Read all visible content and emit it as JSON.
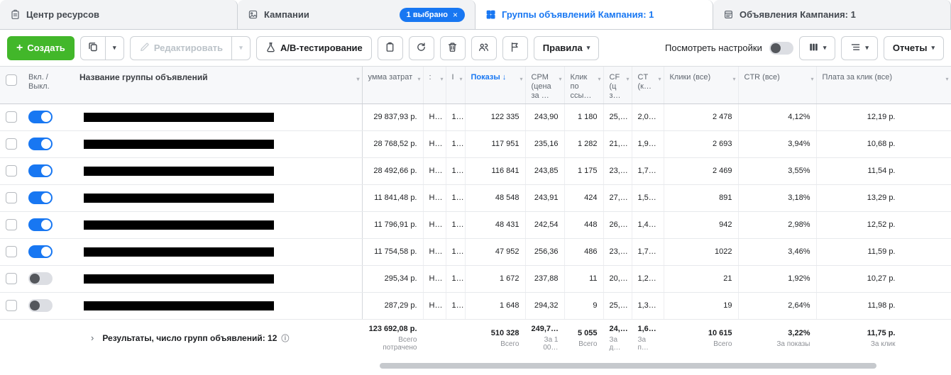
{
  "colors": {
    "accent": "#1877f2",
    "create_button": "#42b72a",
    "toggle_on": "#1877f2"
  },
  "icons": {
    "plus": "+",
    "caret": "▾",
    "close": "×",
    "sort_desc": "↓",
    "chevron": "›",
    "info": "ⓘ"
  },
  "tabs": [
    {
      "label": "Центр ресурсов"
    },
    {
      "label": "Кампании",
      "badge": "1 выбрано"
    },
    {
      "label": "Группы объявлений Кампания: 1",
      "active": true
    },
    {
      "label": "Объявления Кампания: 1"
    }
  ],
  "toolbar": {
    "create_label": "Создать",
    "edit_label": "Редактировать",
    "ab_test_label": "А/В-тестирование",
    "rules_label": "Правила",
    "view_settings_label": "Посмотреть настройки",
    "reports_label": "Отчеты"
  },
  "table": {
    "headers": {
      "toggle": "Вкл. / Выкл.",
      "name": "Название группы объявлений",
      "spend": "умма затрат",
      "col_a": ":",
      "col_b": "I",
      "impressions": "Показы",
      "cpm": "CPM (цена за …",
      "link_clicks": "Клик по ссы…",
      "cpc_link": "CF (ц з…",
      "ctr_link": "CT (к…",
      "clicks_all": "Клики (все)",
      "ctr_all": "CTR (все)",
      "cpc_all": "Плата за клик (все)"
    },
    "rows": [
      {
        "on": true,
        "values": [
          "29 837,93 р.",
          "Н…",
          "1…",
          "122 335",
          "243,90",
          "1 180",
          "25,…",
          "2,0…",
          "2 478",
          "4,12%",
          "12,19 р."
        ]
      },
      {
        "on": true,
        "values": [
          "28 768,52 р.",
          "Н…",
          "1…",
          "117 951",
          "235,16",
          "1 282",
          "21,…",
          "1,9…",
          "2 693",
          "3,94%",
          "10,68 р."
        ]
      },
      {
        "on": true,
        "values": [
          "28 492,66 р.",
          "Н…",
          "1…",
          "116 841",
          "243,85",
          "1 175",
          "23,…",
          "1,7…",
          "2 469",
          "3,55%",
          "11,54 р."
        ]
      },
      {
        "on": true,
        "values": [
          "11 841,48 р.",
          "Н…",
          "1…",
          "48 548",
          "243,91",
          "424",
          "27,…",
          "1,5…",
          "891",
          "3,18%",
          "13,29 р."
        ]
      },
      {
        "on": true,
        "values": [
          "11 796,91 р.",
          "Н…",
          "1…",
          "48 431",
          "242,54",
          "448",
          "26,…",
          "1,4…",
          "942",
          "2,98%",
          "12,52 р."
        ]
      },
      {
        "on": true,
        "values": [
          "11 754,58 р.",
          "Н…",
          "1…",
          "47 952",
          "256,36",
          "486",
          "23,…",
          "1,7…",
          "1022",
          "3,46%",
          "11,59 р."
        ]
      },
      {
        "on": false,
        "values": [
          "295,34 р.",
          "Н…",
          "1…",
          "1 672",
          "237,88",
          "11",
          "20,…",
          "1,2…",
          "21",
          "1,92%",
          "10,27 р."
        ]
      },
      {
        "on": false,
        "values": [
          "287,29 р.",
          "Н…",
          "1…",
          "1 648",
          "294,32",
          "9",
          "25,…",
          "1,3…",
          "19",
          "2,64%",
          "11,98 р."
        ]
      }
    ],
    "footer": {
      "label": "Результаты, число групп объявлений: 12",
      "cells": [
        {
          "v": "123 692,08 р.",
          "sub": "Всего потрачено"
        },
        {
          "v": "",
          "sub": ""
        },
        {
          "v": "",
          "sub": ""
        },
        {
          "v": "510 328",
          "sub": "Всего"
        },
        {
          "v": "249,7…",
          "sub": "За 1 00…"
        },
        {
          "v": "5 055",
          "sub": "Всего"
        },
        {
          "v": "24,…",
          "sub": "За д…"
        },
        {
          "v": "1,6…",
          "sub": "За п…"
        },
        {
          "v": "10 615",
          "sub": "Всего"
        },
        {
          "v": "3,22%",
          "sub": "За показы"
        },
        {
          "v": "11,75 р.",
          "sub": "За клик"
        }
      ]
    }
  }
}
